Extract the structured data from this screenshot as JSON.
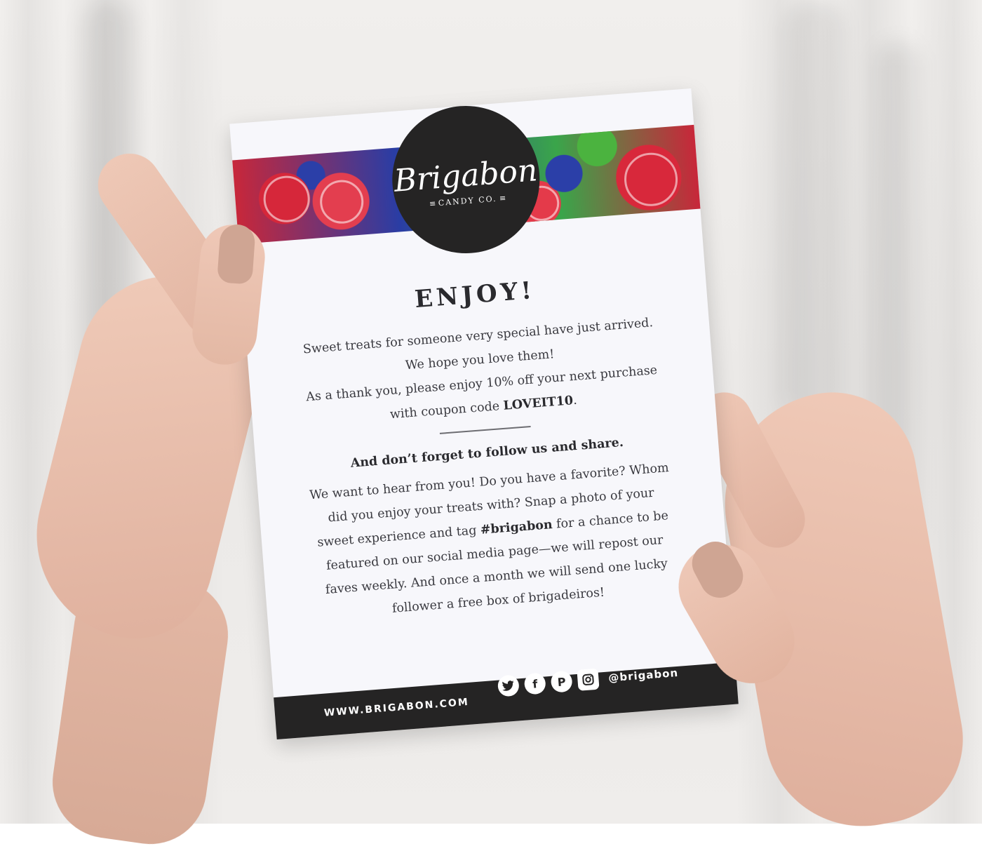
{
  "card": {
    "logo": {
      "word": "Brigabon",
      "sub": "CANDY CO."
    },
    "title": "ENJOY!",
    "intro": "Sweet treats for someone very special have just arrived. We hope you love them!",
    "coupon_text": "As a thank you, please enjoy 10% off your next purchase with coupon code ",
    "coupon_code": "LOVEIT10",
    "coupon_end": ".",
    "follow_heading": "And don’t forget to follow us and share.",
    "body_pre": "We want to hear from you! Do you have a favorite? Whom did you enjoy your treats with? Snap a photo of your sweet experience and tag ",
    "hashtag": "#brigabon",
    "body_post": " for a chance to be featured on our social media page—we will repost our faves weekly. And once a month we will send one lucky follower a free box of brigadeiros!",
    "footer": {
      "url": "WWW.BRIGABON.COM",
      "handle": "@brigabon",
      "icons": [
        "twitter-icon",
        "facebook-icon",
        "pinterest-icon",
        "instagram-icon"
      ]
    }
  },
  "colors": {
    "card_background": "#f7f7fb",
    "footer_background": "#252424",
    "logo_background": "#252424",
    "banner_red": "#d6273a",
    "banner_blue": "#2b3fa8",
    "banner_green": "#4bb33f"
  }
}
